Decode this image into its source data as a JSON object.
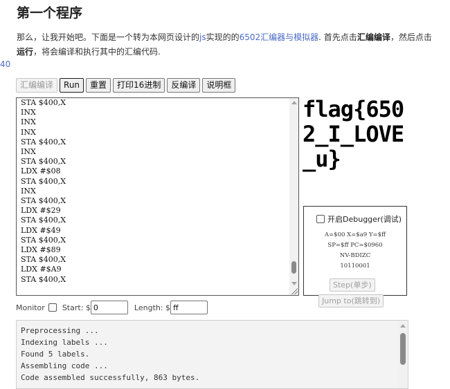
{
  "page": {
    "title": "第一个程序",
    "intro": {
      "p1": "那么，让我开始吧。下面是一个转为本网页设计的",
      "js": "js",
      "p2": "实现的的",
      "link": "6502汇编器与模拟器",
      "p3": ". 首先点击",
      "b1": "汇编编译",
      "p4": "，然后点击 ",
      "b2": "运行",
      "p5": "，将会编译和执行其中的汇编代码."
    },
    "stray_text": "40"
  },
  "toolbar": {
    "compile": "汇编编译",
    "run": "Run",
    "reset": "重置",
    "hexdump": "打印16进制",
    "disassemble": "反编译",
    "notes": "说明框"
  },
  "code_lines": [
    "STA $400,X",
    "INX",
    "INX",
    "INX",
    "STA $400,X",
    "INX",
    "STA $400,X",
    "LDX #$08",
    "STA $400,X",
    "INX",
    "STA $400,X",
    "LDX #$29",
    "STA $400,X",
    "LDX #$49",
    "STA $400,X",
    "LDX #$89",
    "STA $400,X",
    "LDX #$A9",
    "STA $400,X"
  ],
  "screen_output": "flag{6502_I_LOVE_u}",
  "debugger": {
    "toggle_label": "开启Debugger(调试)",
    "reg1": "A=$00 X=$a9 Y=$ff",
    "reg2": "SP=$ff PC=$0960",
    "reg3": "NV-BDIZC",
    "reg4": "10110001",
    "step": "Step(单步)",
    "jump": "Jump to(跳转到)"
  },
  "monitor": {
    "label": "Monitor",
    "start_label": "Start: $",
    "start_value": "0",
    "length_label": "Length: $",
    "length_value": "ff"
  },
  "console_lines": [
    "Preprocessing ...",
    "Indexing labels ...",
    "Found 5 labels.",
    "Assembling code ...",
    "Code assembled successfully, 863 bytes."
  ],
  "colors": {
    "link": "#4a6cc7",
    "console_bg": "#f3f3f3"
  }
}
